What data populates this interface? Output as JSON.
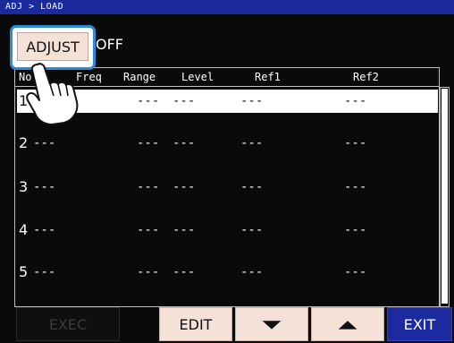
{
  "title_bar": {
    "breadcrumb": "ADJ > LOAD"
  },
  "adjust": {
    "button_label": "ADJUST",
    "state": "OFF"
  },
  "table": {
    "headers": [
      "No.",
      "Freq",
      "Range",
      "Level",
      "Ref1",
      "Ref2"
    ],
    "rows": [
      {
        "no": "1",
        "freq": "---",
        "range": "---",
        "level": "---",
        "ref1": "---",
        "ref2": "---"
      },
      {
        "no": "2",
        "freq": "---",
        "range": "---",
        "level": "---",
        "ref1": "---",
        "ref2": "---"
      },
      {
        "no": "3",
        "freq": "---",
        "range": "---",
        "level": "---",
        "ref1": "---",
        "ref2": "---"
      },
      {
        "no": "4",
        "freq": "---",
        "range": "---",
        "level": "---",
        "ref1": "---",
        "ref2": "---"
      },
      {
        "no": "5",
        "freq": "---",
        "range": "---",
        "level": "---",
        "ref1": "---",
        "ref2": "---"
      }
    ],
    "selected_row": 1
  },
  "bottom_bar": {
    "exec_label": "EXEC",
    "edit_label": "EDIT",
    "down_icon": "down-triangle",
    "up_icon": "up-triangle",
    "exit_label": "EXIT"
  },
  "colors": {
    "title_bar": "#1a2a9c",
    "button_face": "#f4e1d7",
    "exit_button": "#1c2aa0",
    "highlight_border": "#2a8bd6",
    "background": "#0a0a0a"
  }
}
